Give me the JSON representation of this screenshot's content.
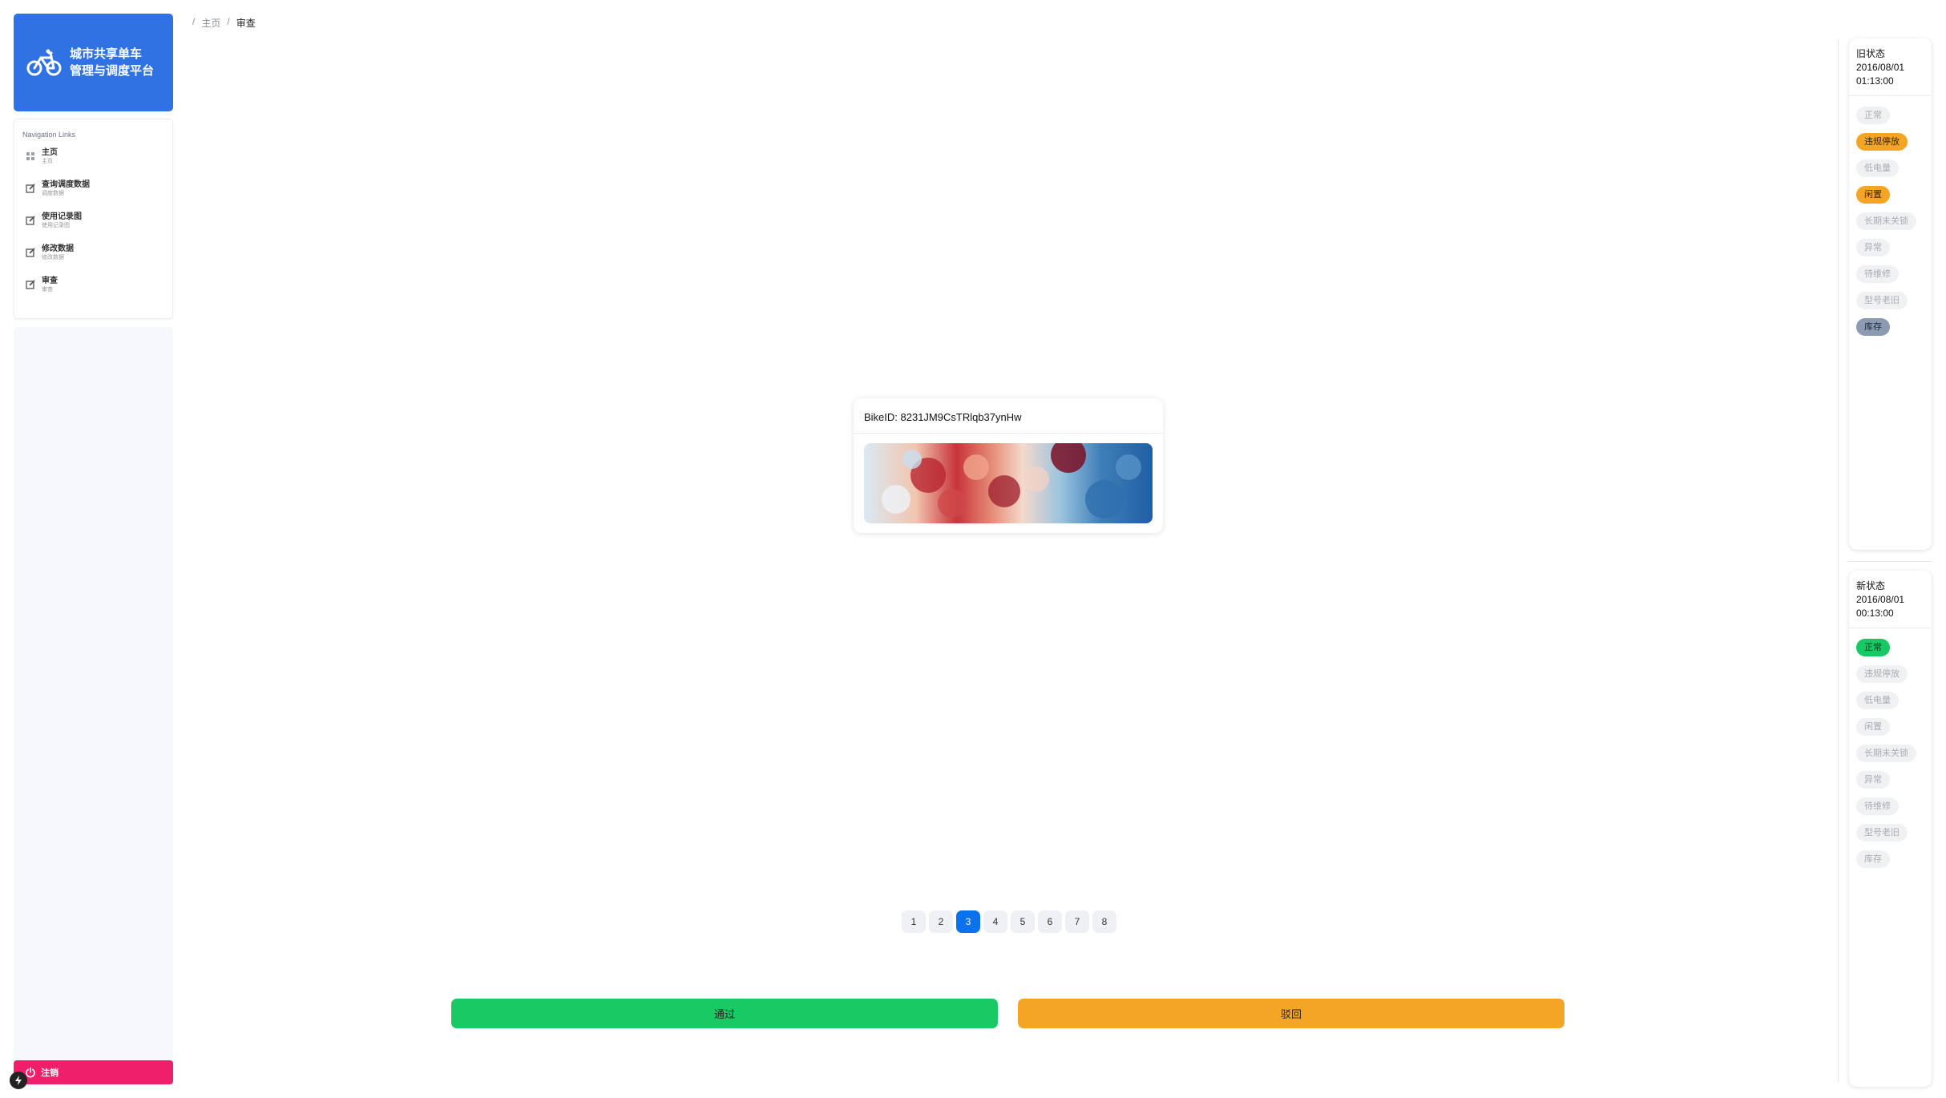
{
  "brand": {
    "title_line1": "城市共享单车",
    "title_line2": "管理与调度平台",
    "icon": "bicycle-icon",
    "color": "#2f72e4"
  },
  "nav": {
    "heading": "Navigation Links",
    "items": [
      {
        "label": "主页",
        "sub": "主页",
        "icon": "dashboard-icon"
      },
      {
        "label": "查询调度数据",
        "sub": "调度数据",
        "icon": "edit-icon"
      },
      {
        "label": "使用记录图",
        "sub": "使用记录图",
        "icon": "edit-icon"
      },
      {
        "label": "修改数据",
        "sub": "修改数据",
        "icon": "edit-icon"
      },
      {
        "label": "审查",
        "sub": "审查",
        "icon": "edit-icon"
      }
    ]
  },
  "logout": {
    "label": "注销",
    "color": "#ef1f6a"
  },
  "breadcrumb": {
    "sep": "/",
    "home": "主页",
    "current": "审查"
  },
  "card": {
    "bike_id_text": "BikeID: 8231JM9CsTRlqb37ynHw"
  },
  "pagination": {
    "pages": [
      "1",
      "2",
      "3",
      "4",
      "5",
      "6",
      "7",
      "8"
    ],
    "current": "3"
  },
  "actions": {
    "pass_label": "通过",
    "pass_color": "#18c964",
    "reject_label": "驳回",
    "reject_color": "#f5a524"
  },
  "old_state": {
    "title": "旧状态",
    "date": "2016/08/01",
    "time": "01:13:00",
    "chips": [
      {
        "label": "正常",
        "style": "off"
      },
      {
        "label": "违规停放",
        "style": "warn"
      },
      {
        "label": "低电量",
        "style": "off"
      },
      {
        "label": "闲置",
        "style": "warn"
      },
      {
        "label": "长期未关锁",
        "style": "off"
      },
      {
        "label": "异常",
        "style": "off"
      },
      {
        "label": "待维修",
        "style": "off"
      },
      {
        "label": "型号老旧",
        "style": "off"
      },
      {
        "label": "库存",
        "style": "info"
      }
    ]
  },
  "new_state": {
    "title": "新状态",
    "date": "2016/08/01",
    "time": "00:13:00",
    "chips": [
      {
        "label": "正常",
        "style": "ok"
      },
      {
        "label": "违规停放",
        "style": "off"
      },
      {
        "label": "低电量",
        "style": "off"
      },
      {
        "label": "闲置",
        "style": "off"
      },
      {
        "label": "长期未关锁",
        "style": "off"
      },
      {
        "label": "异常",
        "style": "off"
      },
      {
        "label": "待维修",
        "style": "off"
      },
      {
        "label": "型号老旧",
        "style": "off"
      },
      {
        "label": "库存",
        "style": "off"
      }
    ]
  }
}
